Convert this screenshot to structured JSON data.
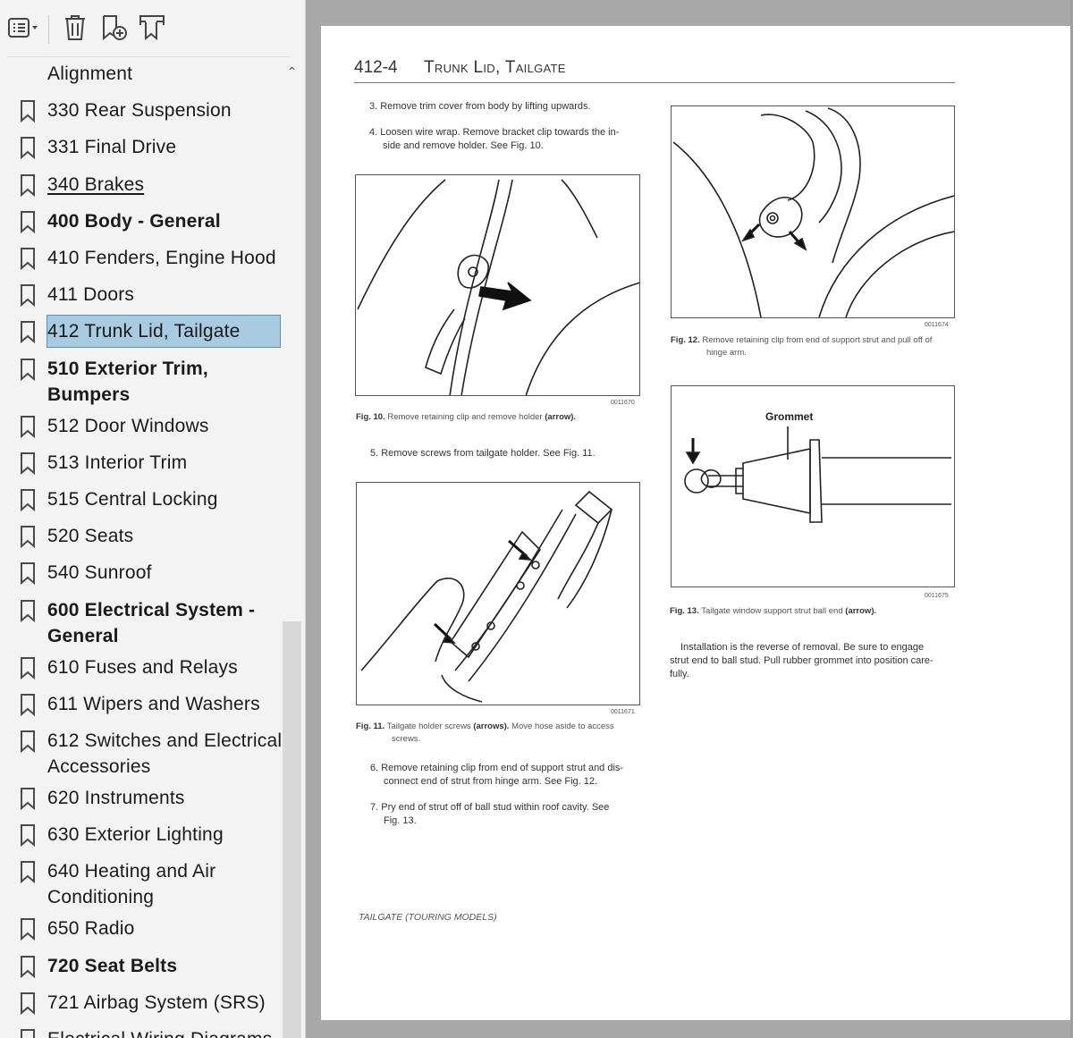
{
  "toolbar": {
    "buttons": [
      {
        "name": "options-menu-icon",
        "icon": "list-with-dropdown"
      },
      {
        "name": "delete-icon",
        "icon": "trash-can"
      },
      {
        "name": "add-bookmark-icon",
        "icon": "bookmark-add"
      },
      {
        "name": "search-bookmark-icon",
        "icon": "bookmark-search"
      }
    ]
  },
  "bookmarks": [
    {
      "label": "Alignment",
      "icon": false,
      "style": "normal"
    },
    {
      "label": "330 Rear Suspension",
      "icon": true,
      "style": "normal"
    },
    {
      "label": "331 Final Drive",
      "icon": true,
      "style": "normal"
    },
    {
      "label": "340 Brakes",
      "icon": true,
      "style": "underline"
    },
    {
      "label": "400 Body - General",
      "icon": true,
      "style": "bold"
    },
    {
      "label": "410 Fenders, Engine Hood",
      "icon": true,
      "style": "normal"
    },
    {
      "label": "411 Doors",
      "icon": true,
      "style": "normal"
    },
    {
      "label": "412 Trunk Lid, Tailgate",
      "icon": true,
      "style": "selected"
    },
    {
      "label": "510 Exterior Trim,",
      "label2": "Bumpers",
      "icon": true,
      "style": "bold"
    },
    {
      "label": "512 Door Windows",
      "icon": true,
      "style": "normal"
    },
    {
      "label": "513 Interior Trim",
      "icon": true,
      "style": "normal"
    },
    {
      "label": "515 Central Locking",
      "icon": true,
      "style": "normal"
    },
    {
      "label": "520 Seats",
      "icon": true,
      "style": "normal"
    },
    {
      "label": "540 Sunroof",
      "icon": true,
      "style": "normal"
    },
    {
      "label": "600 Electrical System -",
      "label2": "General",
      "icon": true,
      "style": "bold"
    },
    {
      "label": "610 Fuses and Relays",
      "icon": true,
      "style": "normal"
    },
    {
      "label": "611 Wipers and Washers",
      "icon": true,
      "style": "normal"
    },
    {
      "label": "612 Switches and Electrical",
      "label2": "Accessories",
      "icon": true,
      "style": "normal"
    },
    {
      "label": "620 Instruments",
      "icon": true,
      "style": "normal"
    },
    {
      "label": "630 Exterior Lighting",
      "icon": true,
      "style": "normal"
    },
    {
      "label": "640 Heating and Air",
      "label2": "Conditioning",
      "icon": true,
      "style": "normal"
    },
    {
      "label": "650 Radio",
      "icon": true,
      "style": "normal"
    },
    {
      "label": "720 Seat Belts",
      "icon": true,
      "style": "bold"
    },
    {
      "label": "721 Airbag System (SRS)",
      "icon": true,
      "style": "normal"
    },
    {
      "label": "Electrical Wiring Diagrams",
      "icon": true,
      "style": "normal"
    }
  ],
  "page": {
    "header_num": "412-4",
    "header_title": "Trunk Lid, Tailgate",
    "step3": "3.  Remove trim cover from body by lifting upwards.",
    "step4_a": "4.  Loosen wire wrap. Remove bracket clip towards the in-",
    "step4_b": "side and remove holder. See Fig. 10.",
    "fig10_num": "0011670",
    "fig10_cap_label": "Fig. 10.",
    "fig10_cap_text": "Remove retaining clip and remove holder",
    "fig10_cap_arrow": "(arrow).",
    "step5": "5.  Remove screws from tailgate holder. See Fig. 11.",
    "fig11_num": "0011671",
    "fig11_cap_label": "Fig. 11.",
    "fig11_cap_text_a": "Tailgate holder screws",
    "fig11_cap_arrows": "(arrows).",
    "fig11_cap_text_b": "Move hose aside to access",
    "fig11_cap_text_c": "screws.",
    "step6_a": "6.  Remove retaining clip from end of support strut and dis-",
    "step6_b": "connect end of strut from hinge arm. See Fig. 12.",
    "step7_a": "7.  Pry end of strut off of ball stud within roof cavity. See",
    "step7_b": "Fig. 13.",
    "footer": "TAILGATE (TOURING MODELS)",
    "fig12_num": "0011674",
    "fig12_cap_label": "Fig. 12.",
    "fig12_cap_text_a": "Remove retaining clip from end of support strut and pull off of",
    "fig12_cap_text_b": "hinge arm.",
    "fig13_label": "Grommet",
    "fig13_num": "0011675",
    "fig13_cap_label": "Fig. 13.",
    "fig13_cap_text": "Tailgate window support strut ball end",
    "fig13_cap_arrow": "(arrow).",
    "install_a": "Installation is the reverse of removal. Be sure to engage",
    "install_b": "strut end to ball stud. Pull rubber grommet into position care-",
    "install_c": "fully."
  }
}
